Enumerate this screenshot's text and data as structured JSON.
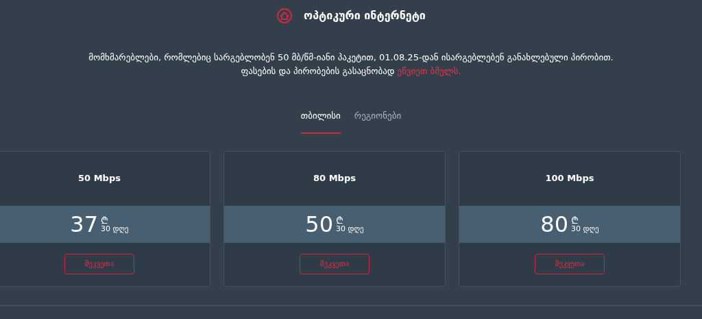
{
  "header": {
    "title": "ოპტიკური ინტერნეტი"
  },
  "notice": {
    "text": "მომხმარებლები, რომლებიც სარგებლობენ 50 მბ/წმ-იანი პაკეტით, 01.08.25-დან ისარგებლებენ განახლებული პირობით. ფასების და პირობების გასაცნობად",
    "link": "ეწვიეთ ბმულს."
  },
  "tabs": [
    {
      "label": "თბილისი",
      "selected": true
    },
    {
      "label": "რეგიონები",
      "selected": false
    }
  ],
  "plans": [
    {
      "speed": "50 Mbps",
      "price": "37",
      "currency": "₾",
      "period": "30 დღე",
      "button": "შეკვეთა"
    },
    {
      "speed": "80 Mbps",
      "price": "50",
      "currency": "₾",
      "period": "30 დღე",
      "button": "შეკვეთა"
    },
    {
      "speed": "100 Mbps",
      "price": "80",
      "currency": "₾",
      "period": "30 დღე",
      "button": "შეკვეთა"
    }
  ]
}
